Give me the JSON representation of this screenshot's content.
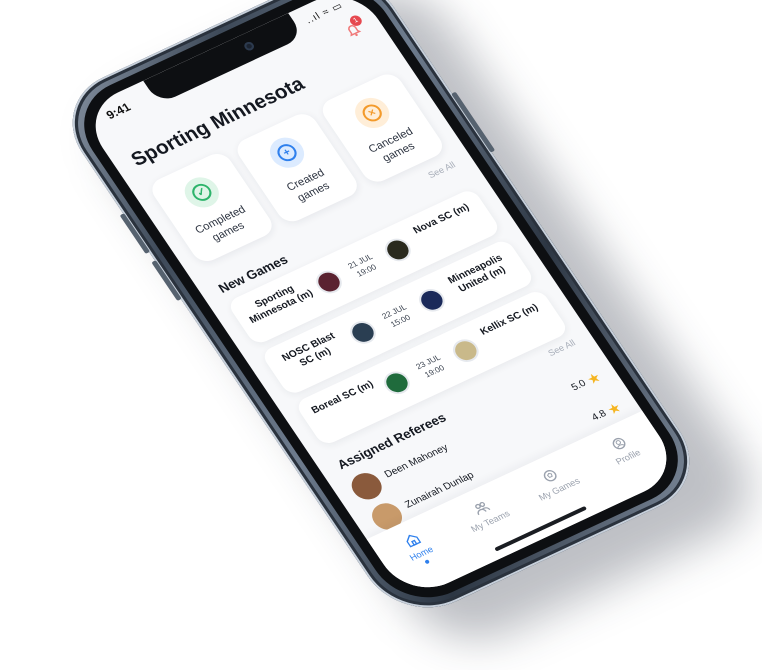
{
  "status": {
    "time": "9:41",
    "icons": "..ıl ≈ ▭",
    "badge_count": "1"
  },
  "header": {
    "title": "Sporting Minnesota"
  },
  "stats": [
    {
      "label": "Completed games",
      "symbol": "✓",
      "color": "#2db46b",
      "bg": "#dff5e8"
    },
    {
      "label": "Created games",
      "symbol": "+",
      "color": "#2f80ed",
      "bg": "#dcebff"
    },
    {
      "label": "Canceled games",
      "symbol": "×",
      "color": "#f39a2b",
      "bg": "#ffeed8"
    }
  ],
  "new_games": {
    "title": "New Games",
    "see_all": "See All",
    "rows": [
      {
        "home": "Sporting Minnesota (m)",
        "away": "Nova SC (m)",
        "date": "21 JUL",
        "time": "19:00",
        "home_logo": "#5a2230",
        "away_logo": "#2a2a1e"
      },
      {
        "home": "NOSC Blast SC (m)",
        "away": "Minneapolis United (m)",
        "date": "22 JUL",
        "time": "15:00",
        "home_logo": "#2a3e52",
        "away_logo": "#1b2a5a"
      },
      {
        "home": "Boreal SC (m)",
        "away": "Kellix SC (m)",
        "date": "23 JUL",
        "time": "19:00",
        "home_logo": "#1f6b3c",
        "away_logo": "#c9b98a"
      }
    ]
  },
  "referees": {
    "title": "Assigned Referees",
    "see_all": "See All",
    "rows": [
      {
        "name": "Deen Mahoney",
        "rating": "5.0",
        "avatar": "#8a5a3c"
      },
      {
        "name": "Zunairah Dunlap",
        "rating": "4.8",
        "avatar": "#c89a6a"
      }
    ]
  },
  "tabs": [
    {
      "label": "Home",
      "icon": "home-icon",
      "active": true
    },
    {
      "label": "My Teams",
      "icon": "teams-icon",
      "active": false
    },
    {
      "label": "My Games",
      "icon": "ball-icon",
      "active": false
    },
    {
      "label": "Profile",
      "icon": "profile-icon",
      "active": false
    }
  ]
}
